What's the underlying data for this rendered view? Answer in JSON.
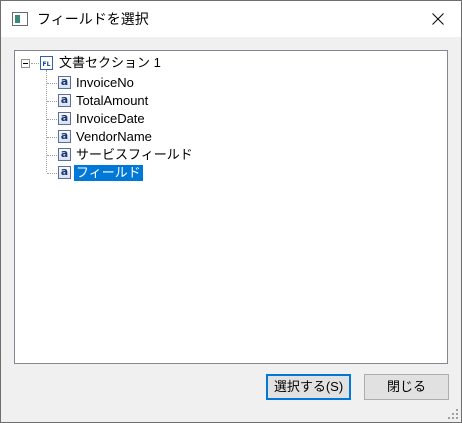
{
  "dialog": {
    "title": "フィールドを選択",
    "close_glyph": "✕"
  },
  "tree": {
    "root": {
      "label": "文書セクション 1",
      "icon_text": "FL",
      "expanded": true
    },
    "items": [
      {
        "label": "InvoiceNo",
        "icon": "a",
        "selected": false
      },
      {
        "label": "TotalAmount",
        "icon": "a",
        "selected": false
      },
      {
        "label": "InvoiceDate",
        "icon": "a",
        "selected": false
      },
      {
        "label": "VendorName",
        "icon": "a",
        "selected": false
      },
      {
        "label": "サービスフィールド",
        "icon": "a",
        "selected": false
      },
      {
        "label": "フィールド",
        "icon": "a",
        "selected": true
      }
    ]
  },
  "buttons": {
    "select_label": "選択する(S)",
    "close_label": "閉じる"
  },
  "colors": {
    "selection": "#0078d7",
    "primary_border": "#0078d7"
  }
}
